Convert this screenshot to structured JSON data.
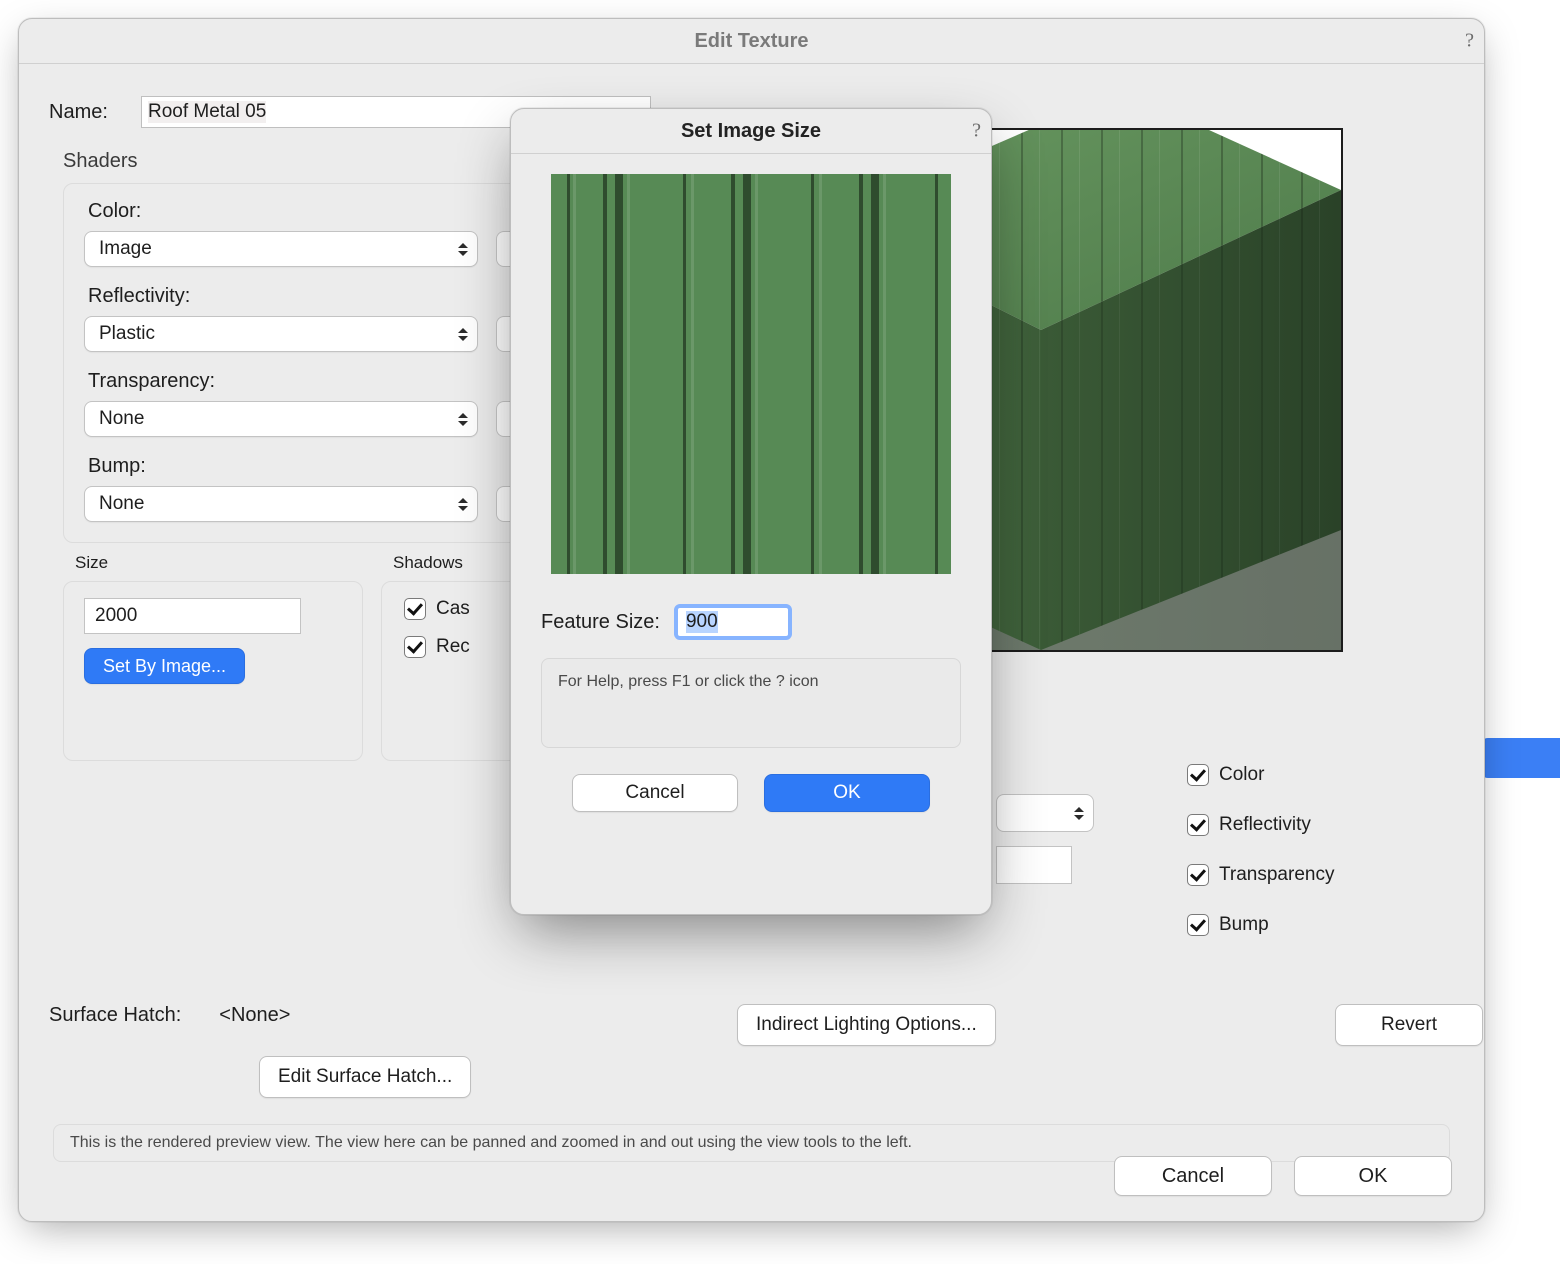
{
  "main": {
    "title": "Edit Texture",
    "name_label": "Name:",
    "name_value": "Roof Metal 05",
    "shaders_header": "Shaders",
    "shaders": {
      "color": {
        "label": "Color:",
        "value": "Image"
      },
      "reflectivity": {
        "label": "Reflectivity:",
        "value": "Plastic"
      },
      "transparency": {
        "label": "Transparency:",
        "value": "None"
      },
      "bump": {
        "label": "Bump:",
        "value": "None"
      }
    },
    "size": {
      "header": "Size",
      "value": "2000",
      "set_by_image": "Set By Image..."
    },
    "shadows": {
      "header": "Shadows",
      "cast": "Cast",
      "receive": "Receive",
      "cast_display": "Cas",
      "receive_display": "Rec"
    },
    "override": {
      "stub_sel": "",
      "stub_in": "",
      "checks": {
        "color": "Color",
        "reflectivity": "Reflectivity",
        "transparency": "Transparency",
        "bump": "Bump"
      }
    },
    "surface_hatch_label": "Surface Hatch:",
    "surface_hatch_value": "<None>",
    "edit_surface_hatch": "Edit Surface Hatch...",
    "indirect_lighting": "Indirect Lighting Options...",
    "revert": "Revert",
    "info": "This is the rendered preview view.  The view here can be panned and zoomed in and out using the view tools to the left.",
    "cancel": "Cancel",
    "ok": "OK"
  },
  "modal": {
    "title": "Set Image Size",
    "feature_size_label": "Feature Size:",
    "feature_size_value": "900",
    "help": "For Help, press F1 or click the ? icon",
    "cancel": "Cancel",
    "ok": "OK",
    "texture_color": "#578a55"
  }
}
